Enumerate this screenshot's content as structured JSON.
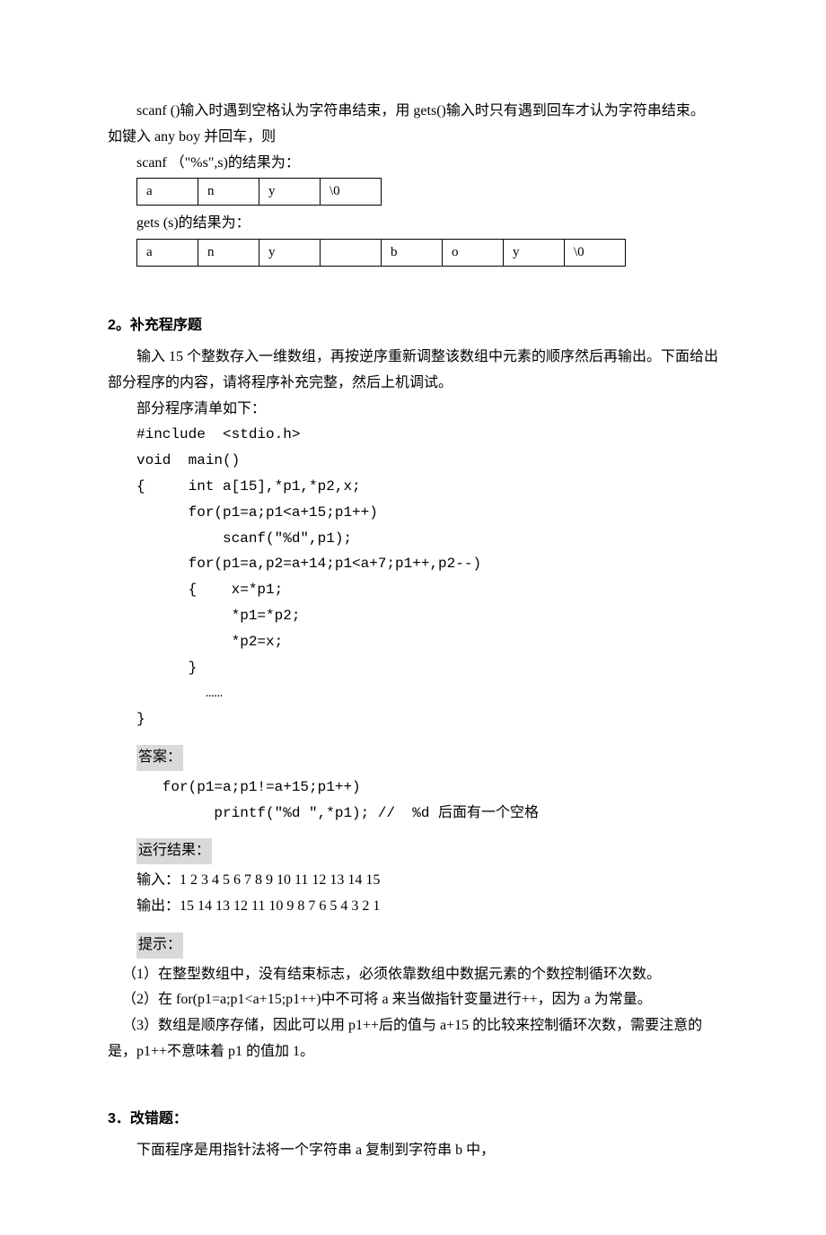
{
  "intro": {
    "p1": "scanf ()输入时遇到空格认为字符串结束，用 gets()输入时只有遇到回车才认为字符串结束。如键入 any  boy 并回车，则",
    "scanf_label": "scanf （\"%s\",s)的结果为：",
    "scanf_cells": [
      "a",
      "n",
      "y",
      "\\0"
    ],
    "gets_label": "gets (s)的结果为：",
    "gets_cells": [
      "a",
      "n",
      "y",
      " ",
      "b",
      "o",
      "y",
      "\\0"
    ]
  },
  "sec2": {
    "title": "2。补充程序题",
    "desc1": "输入 15 个整数存入一维数组，再按逆序重新调整该数组中元素的顺序然后再输出。下面给出部分程序的内容，请将程序补充完整，然后上机调试。",
    "desc2": "部分程序清单如下：",
    "code": "#include  <stdio.h>\nvoid  main()\n{     int a[15],*p1,*p2,x;\n      for(p1=a;p1<a+15;p1++)\n          scanf(\"%d\",p1);\n      for(p1=a,p2=a+14;p1<a+7;p1++,p2--)\n      {    x=*p1;\n           *p1=*p2;\n           *p2=x;\n      }\n        ……\n}",
    "answer_label": "答案：",
    "answer_code": "   for(p1=a;p1!=a+15;p1++)\n         printf(\"%d \",*p1); //  %d 后面有一个空格",
    "run_label": "运行结果：",
    "run1": "输入：1 2 3 4 5 6 7 8 9 10 11 12 13 14 15",
    "run2": "输出：15 14 13 12 11 10 9 8 7 6 5 4 3 2 1",
    "hint_label": "提示：",
    "hint1": "（1）在整型数组中，没有结束标志，必须依靠数组中数据元素的个数控制循环次数。",
    "hint2": "（2）在 for(p1=a;p1<a+15;p1++)中不可将 a 来当做指针变量进行++，因为 a 为常量。",
    "hint3": "（3）数组是顺序存储，因此可以用 p1++后的值与 a+15 的比较来控制循环次数，需要注意的是，p1++不意味着 p1 的值加 1。"
  },
  "sec3": {
    "title": "3．改错题：",
    "desc": "下面程序是用指针法将一个字符串 a 复制到字符串 b 中，"
  }
}
